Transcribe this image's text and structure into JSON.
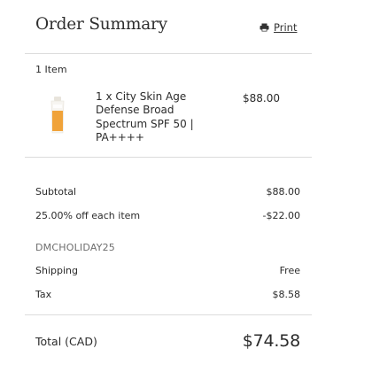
{
  "header": {
    "title": "Order Summary",
    "print_label": "Print",
    "print_icon": "printer-icon"
  },
  "items": {
    "count_label": "1 Item",
    "list": [
      {
        "name": "1 x City Skin Age Defense Broad Spectrum SPF 50 | PA++++",
        "price": "$88.00",
        "thumbnail": "product-tube-image"
      }
    ]
  },
  "summary": {
    "subtotal_label": "Subtotal",
    "subtotal_value": "$88.00",
    "discount_label": "25.00% off each item",
    "discount_value": "-$22.00",
    "promo_code": "DMCHOLIDAY25",
    "shipping_label": "Shipping",
    "shipping_value": "Free",
    "tax_label": "Tax",
    "tax_value": "$8.58"
  },
  "total": {
    "label": "Total (CAD)",
    "value": "$74.58"
  },
  "colors": {
    "text": "#2b2b2b",
    "muted": "#6e6e6e",
    "divider": "#dcdcdc",
    "product_orange": "#f0a33a"
  }
}
